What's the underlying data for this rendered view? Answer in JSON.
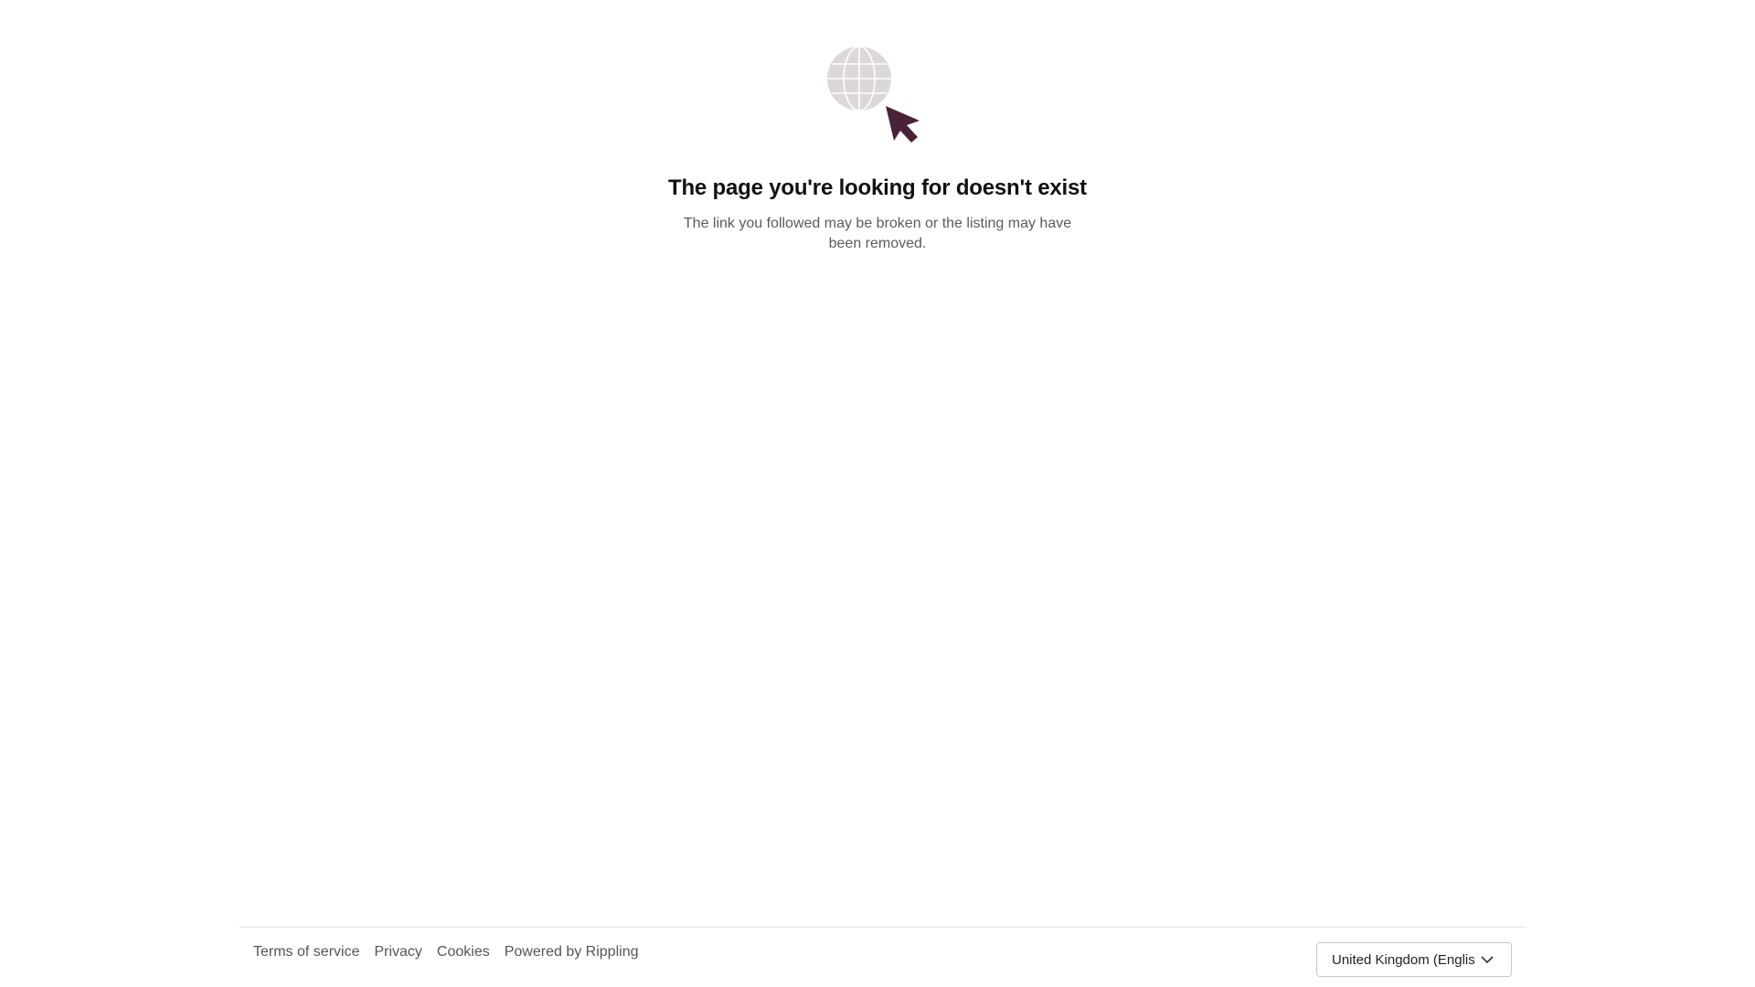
{
  "main": {
    "title": "The page you're looking for doesn't exist",
    "subtitle": "The link you followed may be broken or the listing may have been removed."
  },
  "footer": {
    "links": [
      "Terms of service",
      "Privacy",
      "Cookies",
      "Powered by Rippling"
    ],
    "locale_selected": "United Kingdom (English)"
  },
  "icons": {
    "illustration": "globe-with-cursor-icon",
    "dropdown": "chevron-down-icon"
  },
  "colors": {
    "globe": "#dcd7d9",
    "cursor": "#4a2237",
    "title": "#111111",
    "subtitle": "#5b5b5b",
    "footer_link": "#555555",
    "divider": "#e3e3e3"
  }
}
